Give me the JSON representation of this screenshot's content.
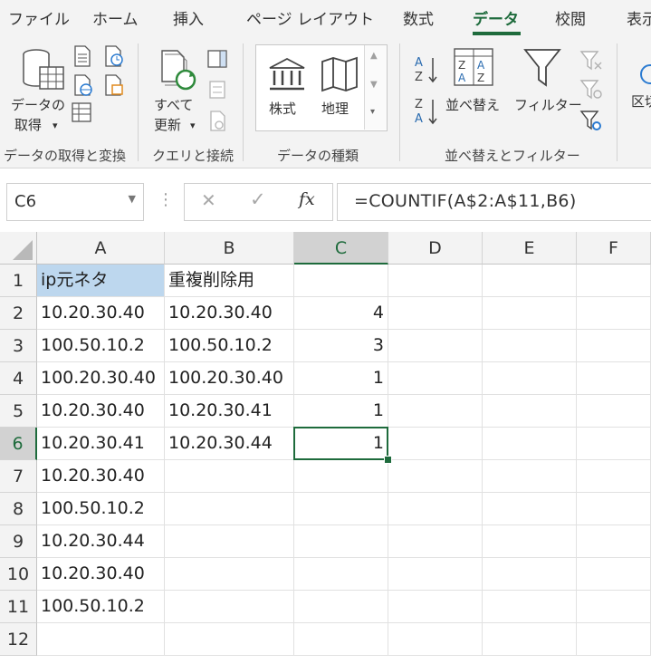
{
  "tabs": [
    {
      "label": "ファイル",
      "active": false
    },
    {
      "label": "ホーム",
      "active": false
    },
    {
      "label": "挿入",
      "active": false
    },
    {
      "label": "ページ レイアウト",
      "active": false
    },
    {
      "label": "数式",
      "active": false
    },
    {
      "label": "データ",
      "active": true
    },
    {
      "label": "校閲",
      "active": false
    },
    {
      "label": "表示",
      "active": false
    }
  ],
  "ribbon": {
    "get_data": {
      "line1": "データの",
      "line2": "取得",
      "dropdown": "▾"
    },
    "refresh_all": {
      "line1": "すべて",
      "line2": "更新",
      "dropdown": "▾"
    },
    "data_types": {
      "stocks": "株式",
      "geography": "地理"
    },
    "sort": {
      "label": "並べ替え",
      "az_top": "A",
      "az_bottom": "Z",
      "za_top": "Z",
      "za_bottom": "A"
    },
    "filter": {
      "label": "フィルター"
    },
    "text_to_columns": {
      "label": "区切"
    },
    "groups": {
      "get_transform": "データの取得と変換",
      "queries": "クエリと接続",
      "data_types": "データの種類",
      "sort_filter": "並べ替えとフィルター"
    },
    "accent_color": "#1e6b3c"
  },
  "formula_bar": {
    "name_box": "C6",
    "cancel_symbol": "✕",
    "enter_symbol": "✓",
    "fx_symbol": "fx",
    "formula": "=COUNTIF(A$2:A$11,B6)"
  },
  "sheet": {
    "columns": [
      "A",
      "B",
      "C",
      "D",
      "E",
      "F"
    ],
    "selected_column": "C",
    "selected_row": 6,
    "rows": [
      {
        "num": "1",
        "cells": [
          "ip元ネタ",
          "重複削除用",
          "",
          "",
          "",
          ""
        ]
      },
      {
        "num": "2",
        "cells": [
          "10.20.30.40",
          "10.20.30.40",
          "4",
          "",
          "",
          ""
        ]
      },
      {
        "num": "3",
        "cells": [
          "100.50.10.2",
          "100.50.10.2",
          "3",
          "",
          "",
          ""
        ]
      },
      {
        "num": "4",
        "cells": [
          "100.20.30.40",
          "100.20.30.40",
          "1",
          "",
          "",
          ""
        ]
      },
      {
        "num": "5",
        "cells": [
          "10.20.30.40",
          "10.20.30.41",
          "1",
          "",
          "",
          ""
        ]
      },
      {
        "num": "6",
        "cells": [
          "10.20.30.41",
          "10.20.30.44",
          "1",
          "",
          "",
          ""
        ]
      },
      {
        "num": "7",
        "cells": [
          "10.20.30.40",
          "",
          "",
          "",
          "",
          ""
        ]
      },
      {
        "num": "8",
        "cells": [
          "100.50.10.2",
          "",
          "",
          "",
          "",
          ""
        ]
      },
      {
        "num": "9",
        "cells": [
          "10.20.30.44",
          "",
          "",
          "",
          "",
          ""
        ]
      },
      {
        "num": "10",
        "cells": [
          "10.20.30.40",
          "",
          "",
          "",
          "",
          ""
        ]
      },
      {
        "num": "11",
        "cells": [
          "100.50.10.2",
          "",
          "",
          "",
          "",
          ""
        ]
      },
      {
        "num": "12",
        "cells": [
          "",
          "",
          "",
          "",
          "",
          ""
        ]
      }
    ],
    "highlight_cell": "A1",
    "highlight_color": "#bdd7ee"
  }
}
